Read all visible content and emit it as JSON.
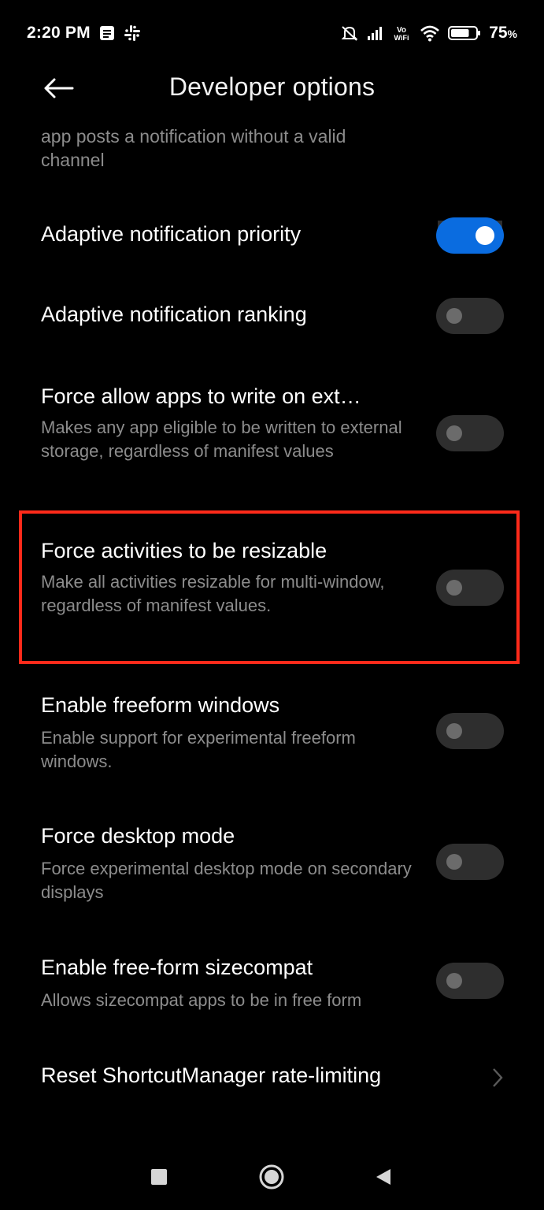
{
  "status_bar": {
    "time": "2:20 PM",
    "battery_percent": "75",
    "battery_suffix": "%",
    "icons": [
      "document-icon",
      "slack-icon",
      "mute-icon",
      "signal-icon",
      "vowifi-icon",
      "wifi-icon",
      "battery-icon"
    ],
    "vowifi_top": "Vo",
    "vowifi_bottom": "WiFi",
    "battery_level": 0.75
  },
  "header": {
    "title": "Developer options",
    "back_icon": "arrow-left-icon"
  },
  "items": [
    {
      "title": "",
      "description": "app posts a notification without a valid channel",
      "toggle": "off"
    },
    {
      "title": "Adaptive notification priority",
      "description": "",
      "toggle": "on"
    },
    {
      "title": "Adaptive notification ranking",
      "description": "",
      "toggle": "off"
    },
    {
      "title": "Force allow apps to write on ext…",
      "description": "Makes any app eligible to be written to external storage, regardless of manifest values",
      "toggle": "off"
    },
    {
      "title": "Force activities to be resizable",
      "description": "Make all activities resizable for multi-window, regardless of manifest values.",
      "toggle": "off",
      "highlighted": true
    },
    {
      "title": "Enable freeform windows",
      "description": "Enable support for experimental freeform windows.",
      "toggle": "off"
    },
    {
      "title": "Force desktop mode",
      "description": "Force experimental desktop mode on secondary displays",
      "toggle": "off"
    },
    {
      "title": "Enable free-form sizecompat",
      "description": "Allows sizecompat apps to be in free form",
      "toggle": "off"
    },
    {
      "title": "Reset ShortcutManager rate-limiting",
      "description": "",
      "control": "chevron-right-icon"
    }
  ],
  "colors": {
    "background": "#000000",
    "accent": "#0a6ce0",
    "highlight": "#ff2a1a",
    "secondary_text": "#8c8c8c"
  },
  "nav_bar": {
    "icons": [
      "recents-square-icon",
      "home-circle-icon",
      "back-triangle-icon"
    ]
  }
}
